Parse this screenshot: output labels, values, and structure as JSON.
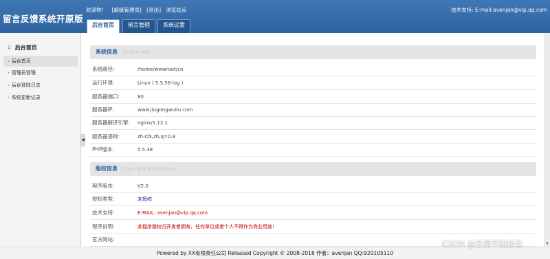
{
  "header": {
    "brand": "留言反馈系统开原版",
    "welcome": "欢迎你！",
    "user_label": "[超级管理员]",
    "logout_label": "[退出]",
    "browse_label": "浏览站点",
    "support": "技术支持: E-mail:avenjan@vip.qq.com"
  },
  "tabs": [
    {
      "label": "后台首页",
      "active": true
    },
    {
      "label": "留言管理",
      "active": false
    },
    {
      "label": "系统设置",
      "active": false
    }
  ],
  "sidebar": {
    "title": "后台首页",
    "items": [
      {
        "label": "后台首页",
        "selected": true
      },
      {
        "label": "管理员管理",
        "selected": false
      },
      {
        "label": "后台登陆日志",
        "selected": false
      },
      {
        "label": "系统更新记录",
        "selected": false
      }
    ]
  },
  "system_info": {
    "title": "系统信息",
    "title_en": "System  Info",
    "rows": [
      {
        "key": "系统路径:",
        "value": "/home/wwwroot/cn"
      },
      {
        "key": "运行环境:",
        "value": "Linux ( 5.5.56-log )"
      },
      {
        "key": "服务器端口:",
        "value": "80"
      },
      {
        "key": "服务器IP:",
        "value": "www.jiugongwuliu.com"
      },
      {
        "key": "服务器解译引擎:",
        "value": "nginx/1.12.1"
      },
      {
        "key": "服务器语种:",
        "value": "zh-CN,zh;q=0.9"
      },
      {
        "key": "PHP版本:",
        "value": "5.5.38"
      }
    ]
  },
  "copyright_info": {
    "title": "版权信息",
    "title_en": "Copyright Information",
    "rows": [
      {
        "key": "程序版本:",
        "value": "V2.0"
      },
      {
        "key": "授权类型:",
        "value": "未授权"
      },
      {
        "key": "技术支持:",
        "value": "E-MAIL: avenjan@vip.qq.com"
      },
      {
        "key": "程序说明:",
        "value": "此程序版权归开发者拥有，任何单位或者个人不得作为商业用途！"
      },
      {
        "key": "官方网站:",
        "value": ""
      }
    ]
  },
  "footer": "Powered by XX有限责任公司  Released Copyright © 2008-2018 作者：avenjan QQ:920105110",
  "watermark": "CSDN @云深不知处㊣",
  "colors": {
    "header": "#2e63a0",
    "link_blue": "#2d5f9e",
    "warning_red": "#c00000"
  }
}
